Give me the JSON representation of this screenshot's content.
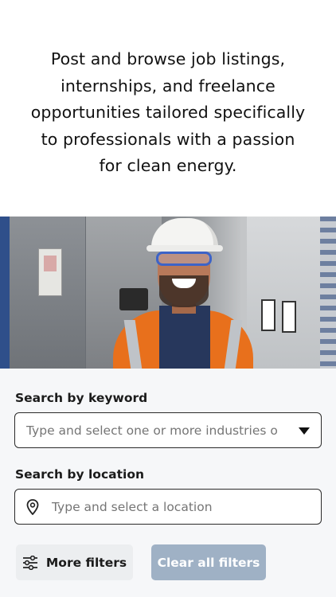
{
  "intro": {
    "lines": [
      "Post and browse job listings,",
      "internships, and freelance",
      "opportunities tailored specifically",
      "to professionals with a passion",
      "for clean energy."
    ]
  },
  "hero": {
    "icon": "worker-photo"
  },
  "search": {
    "keyword_label": "Search by keyword",
    "keyword_placeholder": "Type and select one or more industries or ...",
    "location_label": "Search by location",
    "location_placeholder": "Type and select a location",
    "location_icon": "map-pin-icon",
    "dropdown_icon": "caret-down-icon"
  },
  "buttons": {
    "more_filters": "More filters",
    "more_filters_icon": "sliders-icon",
    "clear_all": "Clear all filters"
  },
  "colors": {
    "clear_button_bg": "#9fb1c5",
    "more_button_bg": "#eceef0",
    "vest": "#e8701c",
    "glasses": "#3d63c7"
  }
}
